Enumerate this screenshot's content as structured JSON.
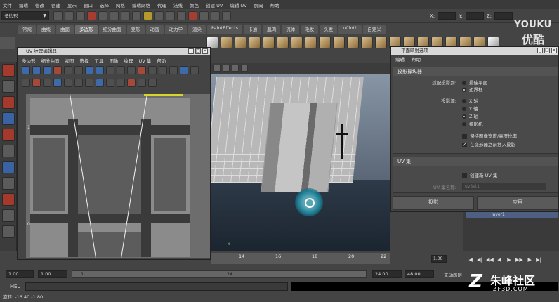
{
  "menubar": [
    "文件",
    "编辑",
    "修改",
    "创建",
    "显示",
    "窗口",
    "选择",
    "网格",
    "编辑网格",
    "代理",
    "法线",
    "颜色",
    "创建 UV",
    "编辑 UV",
    "肌肉",
    "帮助"
  ],
  "statusline": {
    "mode": "多边形",
    "coord_x": "X:",
    "coord_y": "Y:",
    "coord_z": "Z:"
  },
  "shelf_tabs": [
    "常规",
    "曲线",
    "曲面",
    "多边形",
    "细分曲面",
    "变形",
    "动画",
    "动力学",
    "渲染",
    "PaintEffects",
    "卡通",
    "肌肉",
    "流体",
    "毛发",
    "头发",
    "nCloth",
    "自定义"
  ],
  "shelf_active": "多边形",
  "uv_editor": {
    "title": "UV 纹理编辑器",
    "menu": [
      "多边形",
      "细分曲面",
      "视图",
      "选择",
      "工具",
      "图像",
      "纹理",
      "UV 集",
      "帮助"
    ],
    "ruler": [
      "1",
      "0.5"
    ]
  },
  "viewport": {
    "axis_label": "x"
  },
  "options": {
    "title": "平面映射选项",
    "menu": [
      "编辑",
      "帮助"
    ],
    "section1": "投影操纵器",
    "fit_label": "适配投影到:",
    "fit_options": [
      "最佳平面",
      "边界框"
    ],
    "fit_selected": 1,
    "source_label": "投影源:",
    "source_options": [
      "X 轴",
      "Y 轴",
      "Z 轴",
      "摄影机"
    ],
    "source_selected": 2,
    "keep_ratio": "保持图像宽度/高度比率",
    "insert_before": "在变形器之前插入投影",
    "section2": "UV 集",
    "create_new_uvset": "创建新 UV 集",
    "uvset_name_label": "UV 集名称:",
    "uvset_name_value": "uvSet1",
    "btn_project": "投影",
    "btn_apply": "应用"
  },
  "layer": {
    "name": "layer1"
  },
  "timeline": {
    "ticks": [
      "14",
      "16",
      "18",
      "20",
      "22"
    ],
    "current_frame": "1.00"
  },
  "range": {
    "start": "1.00",
    "current": "1.00",
    "inner_start": "1",
    "inner_end": "24",
    "end_a": "24.00",
    "end_b": "48.00",
    "anim_layer": "无动画层"
  },
  "mel": {
    "label": "MEL"
  },
  "help_line": "旋转: -16.40 -1.80",
  "watermark": {
    "youku_en": "YOUKU",
    "youku_cn": "优酷",
    "zf_cn": "朱峰社区",
    "zf_en": "ZF3D.COM"
  },
  "colors": {
    "uv_highlight": "#d7d52a",
    "manipulator": "#1f7f96",
    "layer_row": "#4d5f83"
  }
}
